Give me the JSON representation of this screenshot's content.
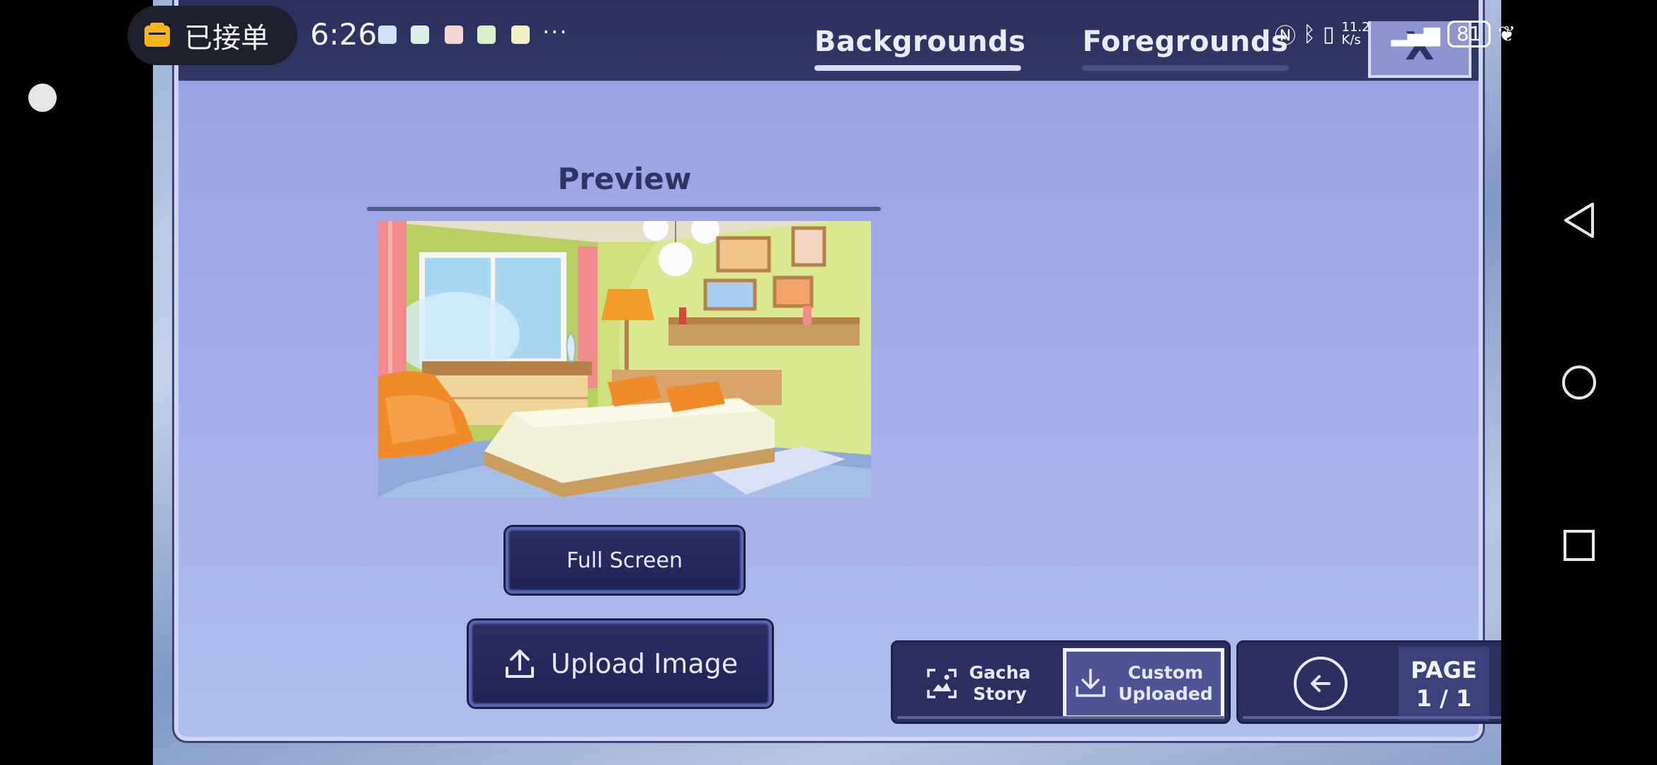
{
  "status_bar": {
    "pill_text": "已接单",
    "time": "6:26",
    "more": "···",
    "speed": "11.2 K/s",
    "battery": "81"
  },
  "header": {
    "tabs": [
      {
        "label": "Backgrounds",
        "active": true
      },
      {
        "label": "Foregrounds",
        "active": false
      }
    ],
    "close_label": "X"
  },
  "preview": {
    "title": "Preview",
    "image_icon": "bedroom-illustration"
  },
  "buttons": {
    "full_screen": "Full Screen",
    "upload_image": "Upload Image"
  },
  "source": {
    "gacha": {
      "line1": "Gacha",
      "line2": "Story"
    },
    "custom": {
      "line1": "Custom",
      "line2": "Uploaded",
      "selected": true
    }
  },
  "pagination": {
    "label": "PAGE",
    "value": "1 / 1"
  },
  "colors": {
    "panel": "#9aa3e6",
    "header": "#2a2f5c",
    "button_dark": "#2a2e63",
    "accent_border": "#f2f4ff"
  }
}
